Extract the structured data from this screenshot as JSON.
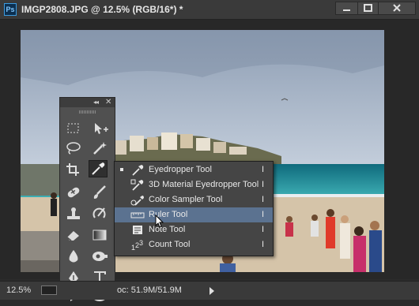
{
  "window": {
    "app_logo": "Ps",
    "title": "IMGP2808.JPG @ 12.5% (RGB/16*) *",
    "controls": [
      "minimize-icon",
      "maximize-icon",
      "close-icon"
    ]
  },
  "tools_panel": {
    "collapse_label": "◂◂",
    "close_label": "✕",
    "tools": [
      {
        "name": "rectangular-marquee-icon",
        "active": false
      },
      {
        "name": "move-tool-icon",
        "active": false
      },
      {
        "name": "lasso-icon",
        "active": false
      },
      {
        "name": "magic-wand-icon",
        "active": false
      },
      {
        "name": "crop-icon",
        "active": false
      },
      {
        "name": "eyedropper-icon",
        "active": true
      },
      {
        "name": "spot-healing-brush-icon",
        "active": false
      },
      {
        "name": "brush-icon",
        "active": false
      },
      {
        "name": "clone-stamp-icon",
        "active": false
      },
      {
        "name": "history-brush-icon",
        "active": false
      },
      {
        "name": "eraser-icon",
        "active": false
      },
      {
        "name": "gradient-icon",
        "active": false
      },
      {
        "name": "blur-icon",
        "active": false
      },
      {
        "name": "dodge-icon",
        "active": false
      },
      {
        "name": "pen-icon",
        "active": false
      },
      {
        "name": "type-tool-icon",
        "active": false
      }
    ]
  },
  "flyout": {
    "items": [
      {
        "label": "Eyedropper Tool",
        "shortcut": "I",
        "icon": "eyedropper-icon",
        "checked": true,
        "highlighted": false
      },
      {
        "label": "3D Material Eyedropper Tool",
        "shortcut": "I",
        "icon": "3d-material-eyedropper-icon",
        "checked": false,
        "highlighted": false
      },
      {
        "label": "Color Sampler Tool",
        "shortcut": "I",
        "icon": "color-sampler-icon",
        "checked": false,
        "highlighted": false
      },
      {
        "label": "Ruler Tool",
        "shortcut": "I",
        "icon": "ruler-icon",
        "checked": false,
        "highlighted": true
      },
      {
        "label": "Note Tool",
        "shortcut": "I",
        "icon": "note-icon",
        "checked": false,
        "highlighted": false
      },
      {
        "label": "Count Tool",
        "shortcut": "I",
        "icon": "count-icon",
        "checked": false,
        "highlighted": false
      }
    ]
  },
  "status_bar": {
    "zoom": "12.5%",
    "doc_info": "oc: 51.9M/51.9M"
  },
  "colors": {
    "highlight": "#5b7290",
    "panel": "#505050",
    "menu": "#454545",
    "titlebar": "#3a3a3a"
  }
}
